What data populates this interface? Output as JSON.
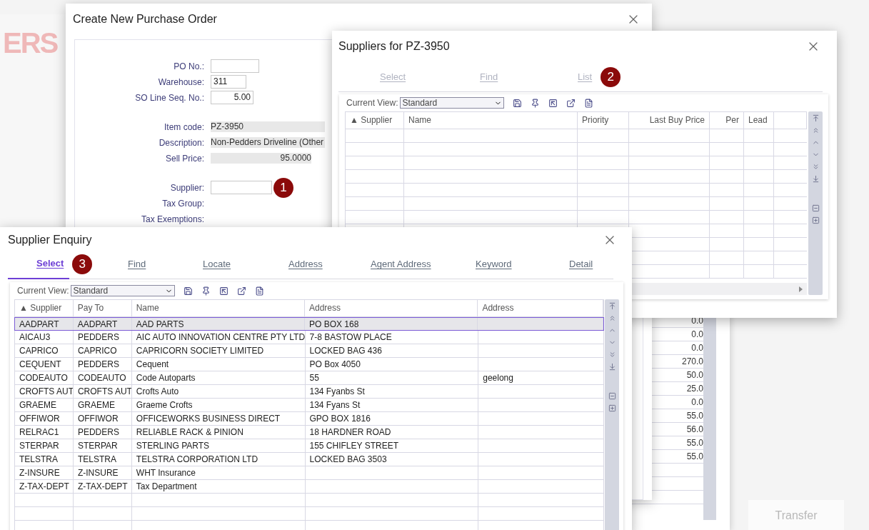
{
  "background": {
    "logo_text": "ERS",
    "transfer_button": "Transfer"
  },
  "items_window": {
    "values": [
      "0.0",
      "0.0",
      "0.0",
      "270.0",
      "50.0",
      "25.0",
      "0.0",
      "55.0",
      "56.0",
      "55.0",
      "55.0"
    ]
  },
  "purchase_order": {
    "title": "Create New Purchase Order",
    "field_groups": [
      [
        {
          "label": "PO No.:",
          "kind": "input"
        },
        {
          "label": "Warehouse:",
          "kind": "input",
          "value": "311"
        },
        {
          "label": "SO Line Seq. No.:",
          "kind": "number_input",
          "value": "5.00"
        }
      ],
      [
        {
          "label": "Item code:",
          "kind": "readonly",
          "value": "PZ-3950"
        },
        {
          "label": "Description:",
          "kind": "readonly",
          "value": "Non-Pedders Driveline (Other"
        },
        {
          "label": "Sell Price:",
          "kind": "number_readonly",
          "value": "95.0000"
        }
      ],
      [
        {
          "label": "Supplier:",
          "kind": "input",
          "badge": "1"
        },
        {
          "label": "Tax Group:",
          "kind": "text"
        },
        {
          "label": "Tax Exemptions:",
          "kind": "text"
        }
      ]
    ]
  },
  "suppliers_window": {
    "title": "Suppliers for PZ-3950",
    "tabs": [
      {
        "label": "Select",
        "selected": false,
        "disabled": true
      },
      {
        "label": "Find",
        "selected": false,
        "disabled": true
      },
      {
        "label": "List",
        "selected": false,
        "disabled": true,
        "badge": "2"
      }
    ],
    "view_label": "Current View:",
    "view_value": "Standard",
    "columns": [
      "▲ Supplier",
      "Name",
      "Priority",
      "Last Buy Price",
      "Per",
      "Lead"
    ]
  },
  "enquiry_window": {
    "title": "Supplier Enquiry",
    "tabs": [
      {
        "label": "Select",
        "selected": true,
        "disabled": false,
        "badge": "3"
      },
      {
        "label": "Find",
        "selected": false,
        "disabled": false
      },
      {
        "label": "Locate",
        "selected": false,
        "disabled": false
      },
      {
        "label": "Address",
        "selected": false,
        "disabled": false
      },
      {
        "label": "Agent Address",
        "selected": false,
        "disabled": false
      },
      {
        "label": "Keyword",
        "selected": false,
        "disabled": false
      },
      {
        "label": "Detail",
        "selected": false,
        "disabled": false
      }
    ],
    "view_label": "Current View:",
    "view_value": "Standard",
    "columns": [
      "▲ Supplier",
      "Pay To",
      "Name",
      "Address",
      "Address"
    ],
    "rows": [
      {
        "selected": true,
        "cells": [
          "AADPART",
          "AADPART",
          "AAD PARTS",
          "PO BOX 168"
        ]
      },
      {
        "selected": false,
        "cells": [
          "AICAU3",
          "PEDDERS",
          "AIC AUTO INNOVATION CENTRE PTY LTD",
          "7-8 BASTOW PLACE"
        ]
      },
      {
        "selected": false,
        "cells": [
          "CAPRICO",
          "CAPRICO",
          "CAPRICORN SOCIETY LIMITED",
          "LOCKED BAG 436"
        ]
      },
      {
        "selected": false,
        "cells": [
          "CEQUENT",
          "PEDDERS",
          "Cequent",
          "PO Box 4050"
        ]
      },
      {
        "selected": false,
        "cells": [
          "CODEAUTO",
          "CODEAUTO",
          "Code Autoparts",
          "55",
          "geelong"
        ]
      },
      {
        "selected": false,
        "cells": [
          "CROFTS AUT",
          "CROFTS AUT",
          "Crofts Auto",
          "134 Fyanbs St"
        ]
      },
      {
        "selected": false,
        "cells": [
          "GRAEME",
          "GRAEME",
          "Graeme Crofts",
          "134 Fyans St"
        ]
      },
      {
        "selected": false,
        "cells": [
          "OFFIWOR",
          "OFFIWOR",
          "OFFICEWORKS BUSINESS DIRECT",
          "GPO BOX 1816"
        ]
      },
      {
        "selected": false,
        "cells": [
          "RELRAC1",
          "PEDDERS",
          "RELIABLE RACK & PINION",
          "18 HARDNER ROAD"
        ]
      },
      {
        "selected": false,
        "cells": [
          "STERPAR",
          "STERPAR",
          "STERLING PARTS",
          "155 CHIFLEY STREET"
        ]
      },
      {
        "selected": false,
        "cells": [
          "TELSTRA",
          "TELSTRA",
          "TELSTRA CORPORATION LTD",
          "LOCKED BAG 3503"
        ]
      },
      {
        "selected": false,
        "cells": [
          "Z-INSURE",
          "Z-INSURE",
          "WHT  Insurance"
        ]
      },
      {
        "selected": false,
        "cells": [
          "Z-TAX-DEPT",
          "Z-TAX-DEPT",
          "Tax Department"
        ]
      }
    ]
  }
}
